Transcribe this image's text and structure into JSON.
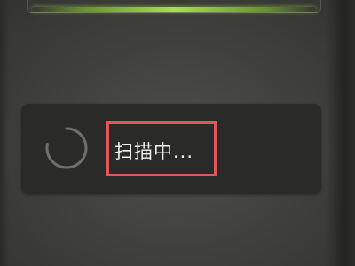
{
  "scan": {
    "status_text": "扫描中...",
    "highlight_color": "#e2575c",
    "scan_line_color": "#a9e04a"
  },
  "icons": {
    "spinner": "loading-spinner-icon"
  }
}
